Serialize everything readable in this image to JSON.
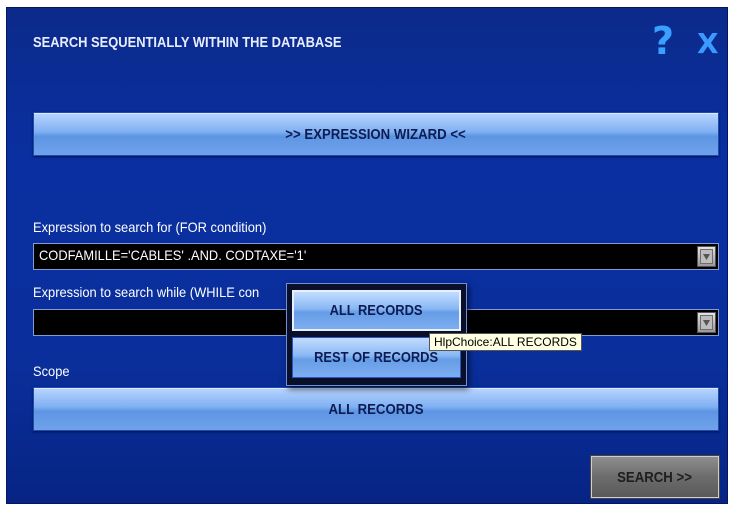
{
  "dialog": {
    "title": "SEARCH SEQUENTIALLY WITHIN THE DATABASE",
    "help_icon": "?",
    "close_icon": "X"
  },
  "wizard_button": {
    "label": ">> EXPRESSION WIZARD <<"
  },
  "for_condition": {
    "label": "Expression to search for (FOR condition)",
    "value": "CODFAMILLE='CABLES' .AND. CODTAXE='1'"
  },
  "while_condition": {
    "label": "Expression to search while (WHILE con",
    "value": ""
  },
  "scope": {
    "label": "Scope",
    "selected": "ALL RECORDS"
  },
  "scope_popup": {
    "options": [
      "ALL RECORDS",
      "REST OF RECORDS"
    ]
  },
  "tooltip": {
    "text": "HlpChoice:ALL RECORDS"
  },
  "search_button": {
    "label": "SEARCH >>"
  },
  "colors": {
    "dialog_bg": "#0a2fa0",
    "button_face": "#7fb0f2",
    "icon_accent": "#3aa0ff"
  }
}
